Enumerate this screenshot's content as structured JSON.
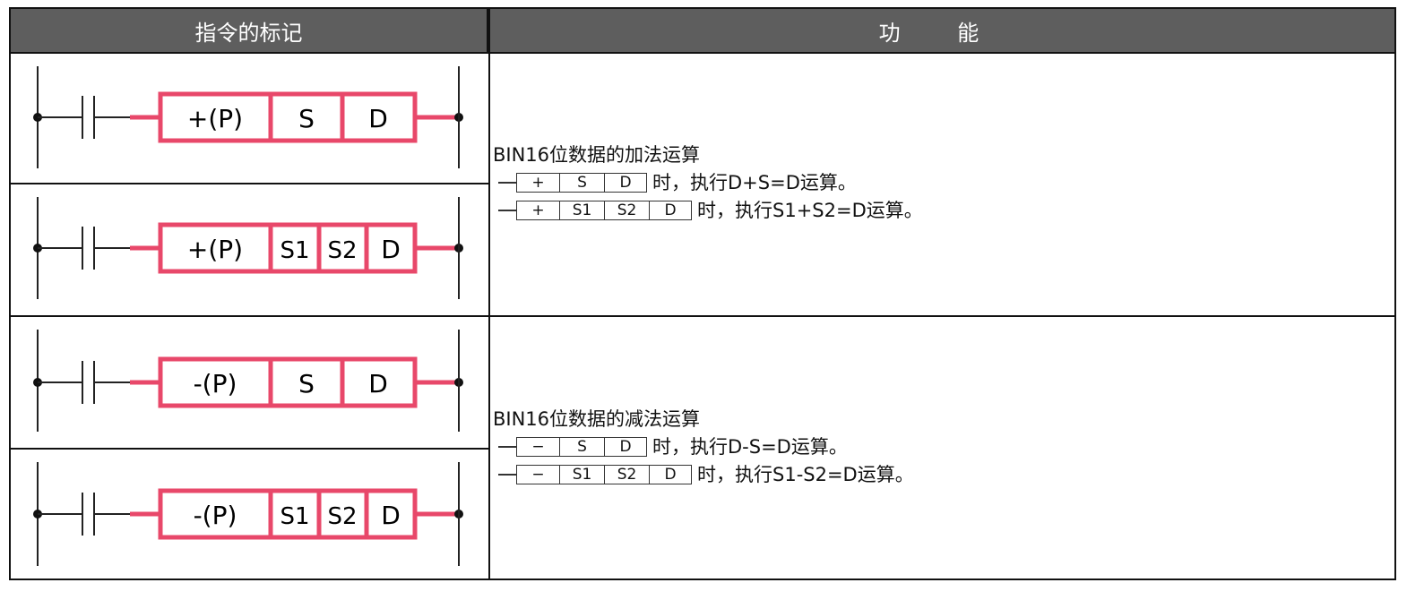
{
  "header": {
    "left": "指令的标记",
    "right": "功 能"
  },
  "ladders": [
    {
      "op": "+(P)",
      "operands": [
        "S",
        "D"
      ]
    },
    {
      "op": "+(P)",
      "operands": [
        "S1",
        "S2",
        "D"
      ]
    },
    {
      "op": "-(P)",
      "operands": [
        "S",
        "D"
      ]
    },
    {
      "op": "-(P)",
      "operands": [
        "S1",
        "S2",
        "D"
      ]
    }
  ],
  "functions": {
    "add": {
      "title": "BIN16位数据的加法运算",
      "lines": [
        {
          "cells": [
            "+",
            "S",
            "D"
          ],
          "text": "时，执行D+S=D运算。"
        },
        {
          "cells": [
            "+",
            "S1",
            "S2",
            "D"
          ],
          "text": "时，执行S1+S2=D运算。"
        }
      ]
    },
    "sub": {
      "title": "BIN16位数据的减法运算",
      "lines": [
        {
          "cells": [
            "−",
            "S",
            "D"
          ],
          "text": "时，执行D-S=D运算。"
        },
        {
          "cells": [
            "−",
            "S1",
            "S2",
            "D"
          ],
          "text": "时，执行S1-S2=D运算。"
        }
      ]
    }
  },
  "colors": {
    "instruction_box": "#e8486a",
    "header_bg": "#5e5e5e"
  }
}
